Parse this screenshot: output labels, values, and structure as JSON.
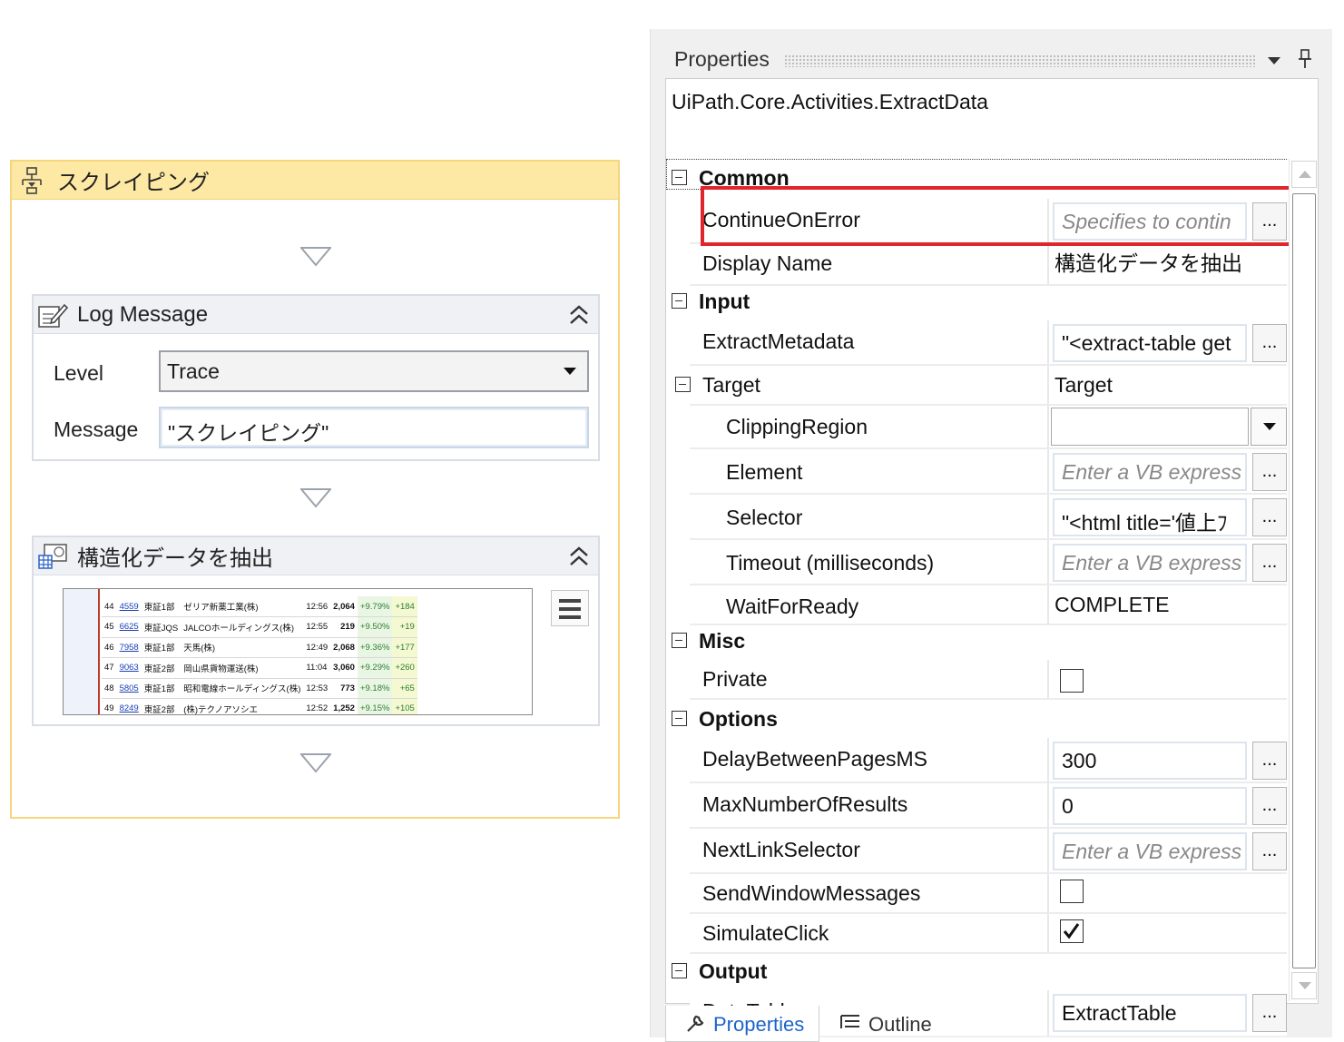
{
  "designer": {
    "sequence_title": "スクレイピング",
    "log_message": {
      "title": "Log Message",
      "level_label": "Level",
      "level_value": "Trace",
      "message_label": "Message",
      "message_value": "\"スクレイピング\""
    },
    "extract": {
      "title": "構造化データを抽出",
      "preview_rows": [
        {
          "no": "44",
          "code": "4559",
          "market": "東証1部",
          "name": "ゼリア新薬工業(株)",
          "time": "12:56",
          "price": "2,064",
          "pct": "+9.79%",
          "chg": "+184"
        },
        {
          "no": "45",
          "code": "6625",
          "market": "東証JQS",
          "name": "JALCOホールディングス(株)",
          "time": "12:55",
          "price": "219",
          "pct": "+9.50%",
          "chg": "+19"
        },
        {
          "no": "46",
          "code": "7958",
          "market": "東証1部",
          "name": "天馬(株)",
          "time": "12:49",
          "price": "2,068",
          "pct": "+9.36%",
          "chg": "+177"
        },
        {
          "no": "47",
          "code": "9063",
          "market": "東証2部",
          "name": "岡山県貨物運送(株)",
          "time": "11:04",
          "price": "3,060",
          "pct": "+9.29%",
          "chg": "+260"
        },
        {
          "no": "48",
          "code": "5805",
          "market": "東証1部",
          "name": "昭和電線ホールディングス(株)",
          "time": "12:53",
          "price": "773",
          "pct": "+9.18%",
          "chg": "+65"
        },
        {
          "no": "49",
          "code": "8249",
          "market": "東証2部",
          "name": "(株)テクノアソシエ",
          "time": "12:52",
          "price": "1,252",
          "pct": "+9.15%",
          "chg": "+105"
        }
      ]
    }
  },
  "properties": {
    "panel_title": "Properties",
    "type_name": "UiPath.Core.Activities.ExtractData",
    "categories": {
      "common": "Common",
      "input": "Input",
      "misc": "Misc",
      "options": "Options",
      "output": "Output"
    },
    "rows": {
      "continue_on_error": {
        "label": "ContinueOnError",
        "value": "Specifies to contin"
      },
      "display_name": {
        "label": "Display Name",
        "value": "構造化データを抽出"
      },
      "extract_metadata": {
        "label": "ExtractMetadata",
        "value": "\"<extract-table get"
      },
      "target": {
        "label": "Target",
        "value": "Target"
      },
      "clipping_region": {
        "label": "ClippingRegion",
        "value": ""
      },
      "element": {
        "label": "Element",
        "value": "Enter a VB express"
      },
      "selector": {
        "label": "Selector",
        "value": "\"<html title='値上ﾌ"
      },
      "timeout": {
        "label": "Timeout (milliseconds)",
        "value": "Enter a VB express"
      },
      "wait_for_ready": {
        "label": "WaitForReady",
        "value": "COMPLETE"
      },
      "private": {
        "label": "Private",
        "checked": false
      },
      "delay_between_pages": {
        "label": "DelayBetweenPagesMS",
        "value": "300"
      },
      "max_results": {
        "label": "MaxNumberOfResults",
        "value": "0"
      },
      "next_link_selector": {
        "label": "NextLinkSelector",
        "value": "Enter a VB express"
      },
      "send_window_messages": {
        "label": "SendWindowMessages",
        "checked": false
      },
      "simulate_click": {
        "label": "SimulateClick",
        "checked": true
      },
      "data_table": {
        "label": "DataTable",
        "value": "ExtractTable"
      }
    },
    "ellipsis": "...",
    "tabs": {
      "properties": "Properties",
      "outline": "Outline"
    }
  }
}
